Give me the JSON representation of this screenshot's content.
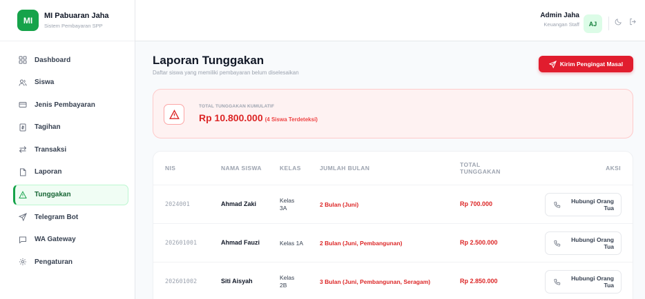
{
  "brand": {
    "logo": "MI",
    "title": "MI Pabuaran Jaha",
    "subtitle": "Sistem Pembayaran SPP"
  },
  "sidebar": {
    "items": [
      {
        "label": "Dashboard",
        "icon": "grid-icon",
        "active": false
      },
      {
        "label": "Siswa",
        "icon": "users-icon",
        "active": false
      },
      {
        "label": "Jenis Pembayaran",
        "icon": "card-icon",
        "active": false
      },
      {
        "label": "Tagihan",
        "icon": "invoice-icon",
        "active": false
      },
      {
        "label": "Transaksi",
        "icon": "transfer-icon",
        "active": false
      },
      {
        "label": "Laporan",
        "icon": "file-icon",
        "active": false
      },
      {
        "label": "Tunggakan",
        "icon": "warning-icon",
        "active": true
      },
      {
        "label": "Telegram Bot",
        "icon": "send-icon",
        "active": false
      },
      {
        "label": "WA Gateway",
        "icon": "chat-icon",
        "active": false
      },
      {
        "label": "Pengaturan",
        "icon": "gear-icon",
        "active": false
      }
    ]
  },
  "header": {
    "user_name": "Admin Jaha",
    "user_role": "Keuangan Staff",
    "avatar": "AJ"
  },
  "main": {
    "title": "Laporan Tunggakan",
    "subtitle": "Daftar siswa yang memiliki pembayaran belum diselesaikan",
    "remind_button": "Kirim Pengingat Masal"
  },
  "summary": {
    "label": "TOTAL TUNGGAKAN KUMULATIF",
    "amount": "Rp 10.800.000",
    "count": "(4 Siswa Terdeteksi)"
  },
  "table": {
    "headers": {
      "nis": "NIS",
      "nama": "NAMA SISWA",
      "kelas": "KELAS",
      "bulan": "JUMLAH BULAN",
      "total": "TOTAL TUNGGAKAN",
      "aksi": "AKSI"
    },
    "action_label": "Hubungi Orang Tua",
    "rows": [
      {
        "nis": "2024001",
        "nama": "Ahmad Zaki",
        "kelas": "Kelas 3A",
        "bulan": "2 Bulan (Juni)",
        "total": "Rp 700.000"
      },
      {
        "nis": "202601001",
        "nama": "Ahmad Fauzi",
        "kelas": "Kelas 1A",
        "bulan": "2 Bulan (Juni, Pembangunan)",
        "total": "Rp 2.500.000"
      },
      {
        "nis": "202601002",
        "nama": "Siti Aisyah",
        "kelas": "Kelas 2B",
        "bulan": "3 Bulan (Juni, Pembangunan, Seragam)",
        "total": "Rp 2.850.000"
      }
    ]
  },
  "colors": {
    "brand": "#16a34a",
    "danger": "#dc2626",
    "button": "#e11d2e"
  }
}
